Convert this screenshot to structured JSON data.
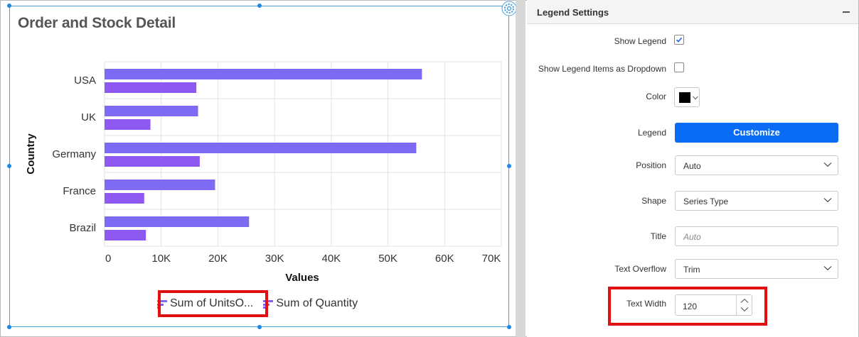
{
  "widget": {
    "title": "Order and Stock Detail",
    "accent_color": "#1e88e5"
  },
  "chart_data": {
    "type": "bar",
    "orientation": "horizontal",
    "categories": [
      "USA",
      "UK",
      "Germany",
      "France",
      "Brazil"
    ],
    "series": [
      {
        "name": "Sum of UnitsO...",
        "color": "#7d6cf3",
        "values": [
          56000,
          16500,
          55000,
          19500,
          25500
        ]
      },
      {
        "name": "Sum of Quantity",
        "color": "#8e59f0",
        "values": [
          16200,
          8100,
          16800,
          7000,
          7300
        ]
      }
    ],
    "xlabel": "Values",
    "ylabel": "Country",
    "xlim": [
      0,
      70000
    ],
    "x_ticks": [
      "0",
      "10K",
      "20K",
      "30K",
      "40K",
      "50K",
      "60K",
      "70K"
    ],
    "grid": true,
    "legend_position": "bottom"
  },
  "panel": {
    "title": "Legend Settings",
    "show_legend_label": "Show Legend",
    "show_legend_checked": true,
    "dropdown_items_label": "Show Legend Items as Dropdown",
    "dropdown_items_checked": false,
    "color_label": "Color",
    "color_value": "#000000",
    "legend_label": "Legend",
    "customize_label": "Customize",
    "position_label": "Position",
    "position_value": "Auto",
    "shape_label": "Shape",
    "shape_value": "Series Type",
    "title_label": "Title",
    "title_placeholder": "Auto",
    "text_overflow_label": "Text Overflow",
    "text_overflow_value": "Trim",
    "text_width_label": "Text Width",
    "text_width_value": "120"
  }
}
